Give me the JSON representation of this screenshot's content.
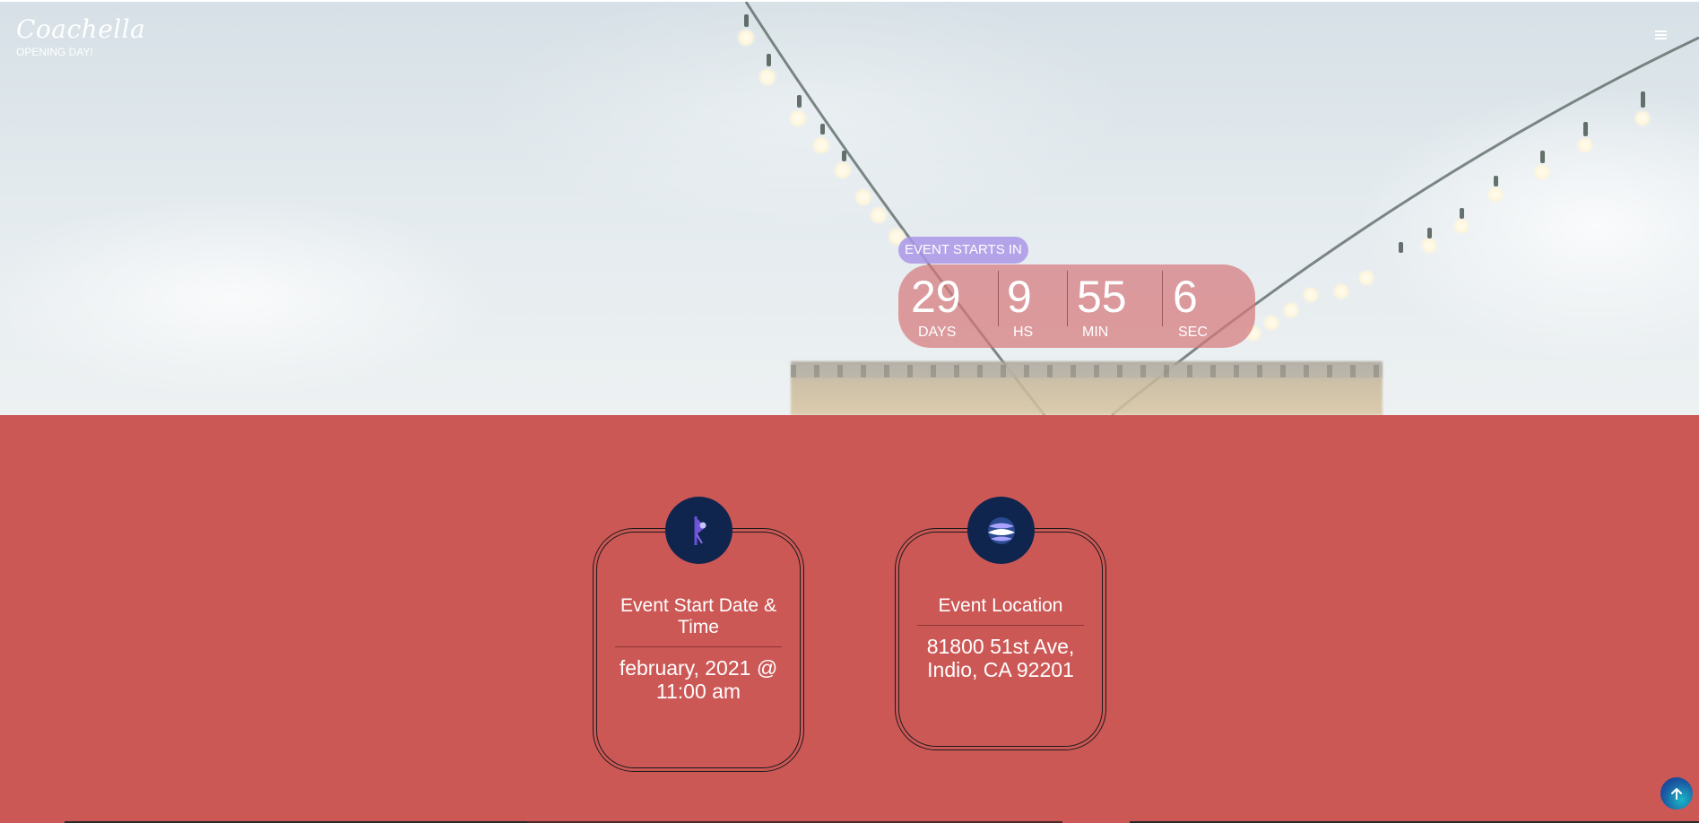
{
  "brand": {
    "name": "Coachella",
    "tagline": "OPENING DAY!"
  },
  "header": {
    "menu_icon": "hamburger-menu-icon"
  },
  "countdown": {
    "label": "EVENT STARTS IN",
    "units": [
      {
        "value": "29",
        "label": "DAYS"
      },
      {
        "value": "9",
        "label": "HS"
      },
      {
        "value": "55",
        "label": "MIN"
      },
      {
        "value": "6",
        "label": "SEC"
      }
    ]
  },
  "cards": [
    {
      "icon": "flag-icon",
      "title": "Event Start Date & Time",
      "value": "february, 2021 @ 11:00 am"
    },
    {
      "icon": "planet-globe-icon",
      "title": "Event Location",
      "value": "81800 51st Ave, Indio, CA 92201"
    }
  ],
  "scroll_top": {
    "icon": "arrow-up-icon"
  },
  "colors": {
    "section_background": "#cc5856",
    "countdown_background": "#d6787c",
    "label_pill": "#aa96e6",
    "icon_circle": "#10254d"
  }
}
